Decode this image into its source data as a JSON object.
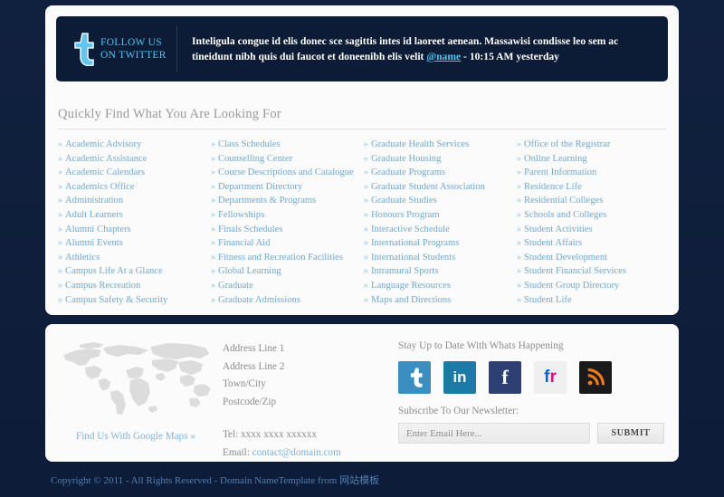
{
  "twitter": {
    "follow_line1": "FOLLOW US",
    "follow_line2": "ON TWITTER",
    "bird_icon": "twitter-bird-icon",
    "tweet_text_before": "Inteligula congue id elis donec sce sagittis intes id laoreet aenean. Massawisi condisse leo sem ac tineidunt nibh quis dui faucot et doneenibh elis velit ",
    "tweet_handle": "@name",
    "tweet_text_after": " - 10:15 AM yesterday",
    "accent_color": "#4cc5f2",
    "bar_color": "#0c1c36"
  },
  "quick_find": {
    "title": "Quickly Find What You Are Looking For",
    "link_color": "#6fa8d4",
    "bullet": "»",
    "columns": [
      [
        "Academic Advisory",
        "Academic Assistance",
        "Academic Calendars",
        "Academics Office",
        "Administration",
        "Adult Learners",
        "Alumni Chapters",
        "Alumni Events",
        "Athletics",
        "Campus Life At a Glance",
        "Campus Recreation",
        "Campus Safety & Security"
      ],
      [
        "Class Schedules",
        "Counselling Center",
        "Course Descriptions and Catalogue",
        "Department Directory",
        "Departments & Programs",
        "Fellowships",
        "Finals Schedules",
        "Financial Aid",
        "Fitness and Recreation Facilities",
        "Global Learning",
        "Graduate",
        "Graduate Admissions"
      ],
      [
        "Graduate Health Services",
        "Graduate Housing",
        "Graduate Programs",
        "Graduate Student Association",
        "Graduate Studies",
        "Honours Program",
        "Interactive Schedule",
        "International Programs",
        "International Students",
        "Intramural Sports",
        "Language Resources",
        "Maps and Directions"
      ],
      [
        "Office of the Registrar",
        "Online Learning",
        "Parent Information",
        "Residence Life",
        "Residential Colleges",
        "Schools and Colleges",
        "Student Activities",
        "Student Affairs",
        "Student Development",
        "Student Financial Services",
        "Student Group Directory",
        "Student Life"
      ]
    ]
  },
  "footer": {
    "map_icon": "world-map-icon",
    "map_link": "Find Us With Google Maps »",
    "address": [
      "Address Line 1",
      "Address Line 2",
      "Town/City",
      "Postcode/Zip"
    ],
    "tel": "Tel: xxxx xxxx xxxxxx",
    "email_label": "Email: ",
    "email": "contact@domain.com",
    "social_title": "Stay Up to Date With Whats Happening",
    "social": [
      {
        "name": "twitter",
        "glyph": "t",
        "bg": "#3b8fc0"
      },
      {
        "name": "linkedin",
        "glyph": "in",
        "bg": "#1b7ba6"
      },
      {
        "name": "facebook",
        "glyph": "f",
        "bg": "#2e3f73"
      },
      {
        "name": "flickr",
        "glyph": "fr",
        "bg": "#efefef"
      },
      {
        "name": "rss",
        "glyph": "rss",
        "bg": "#1a1a1a"
      }
    ],
    "newsletter_label": "Subscribe To Our Newsletter:",
    "newsletter_placeholder": "Enter Email Here...",
    "submit_label": "SUBMIT"
  },
  "copyright": "Copyright © 2011 - All Rights Reserved - Domain NameTemplate from 网站模板"
}
